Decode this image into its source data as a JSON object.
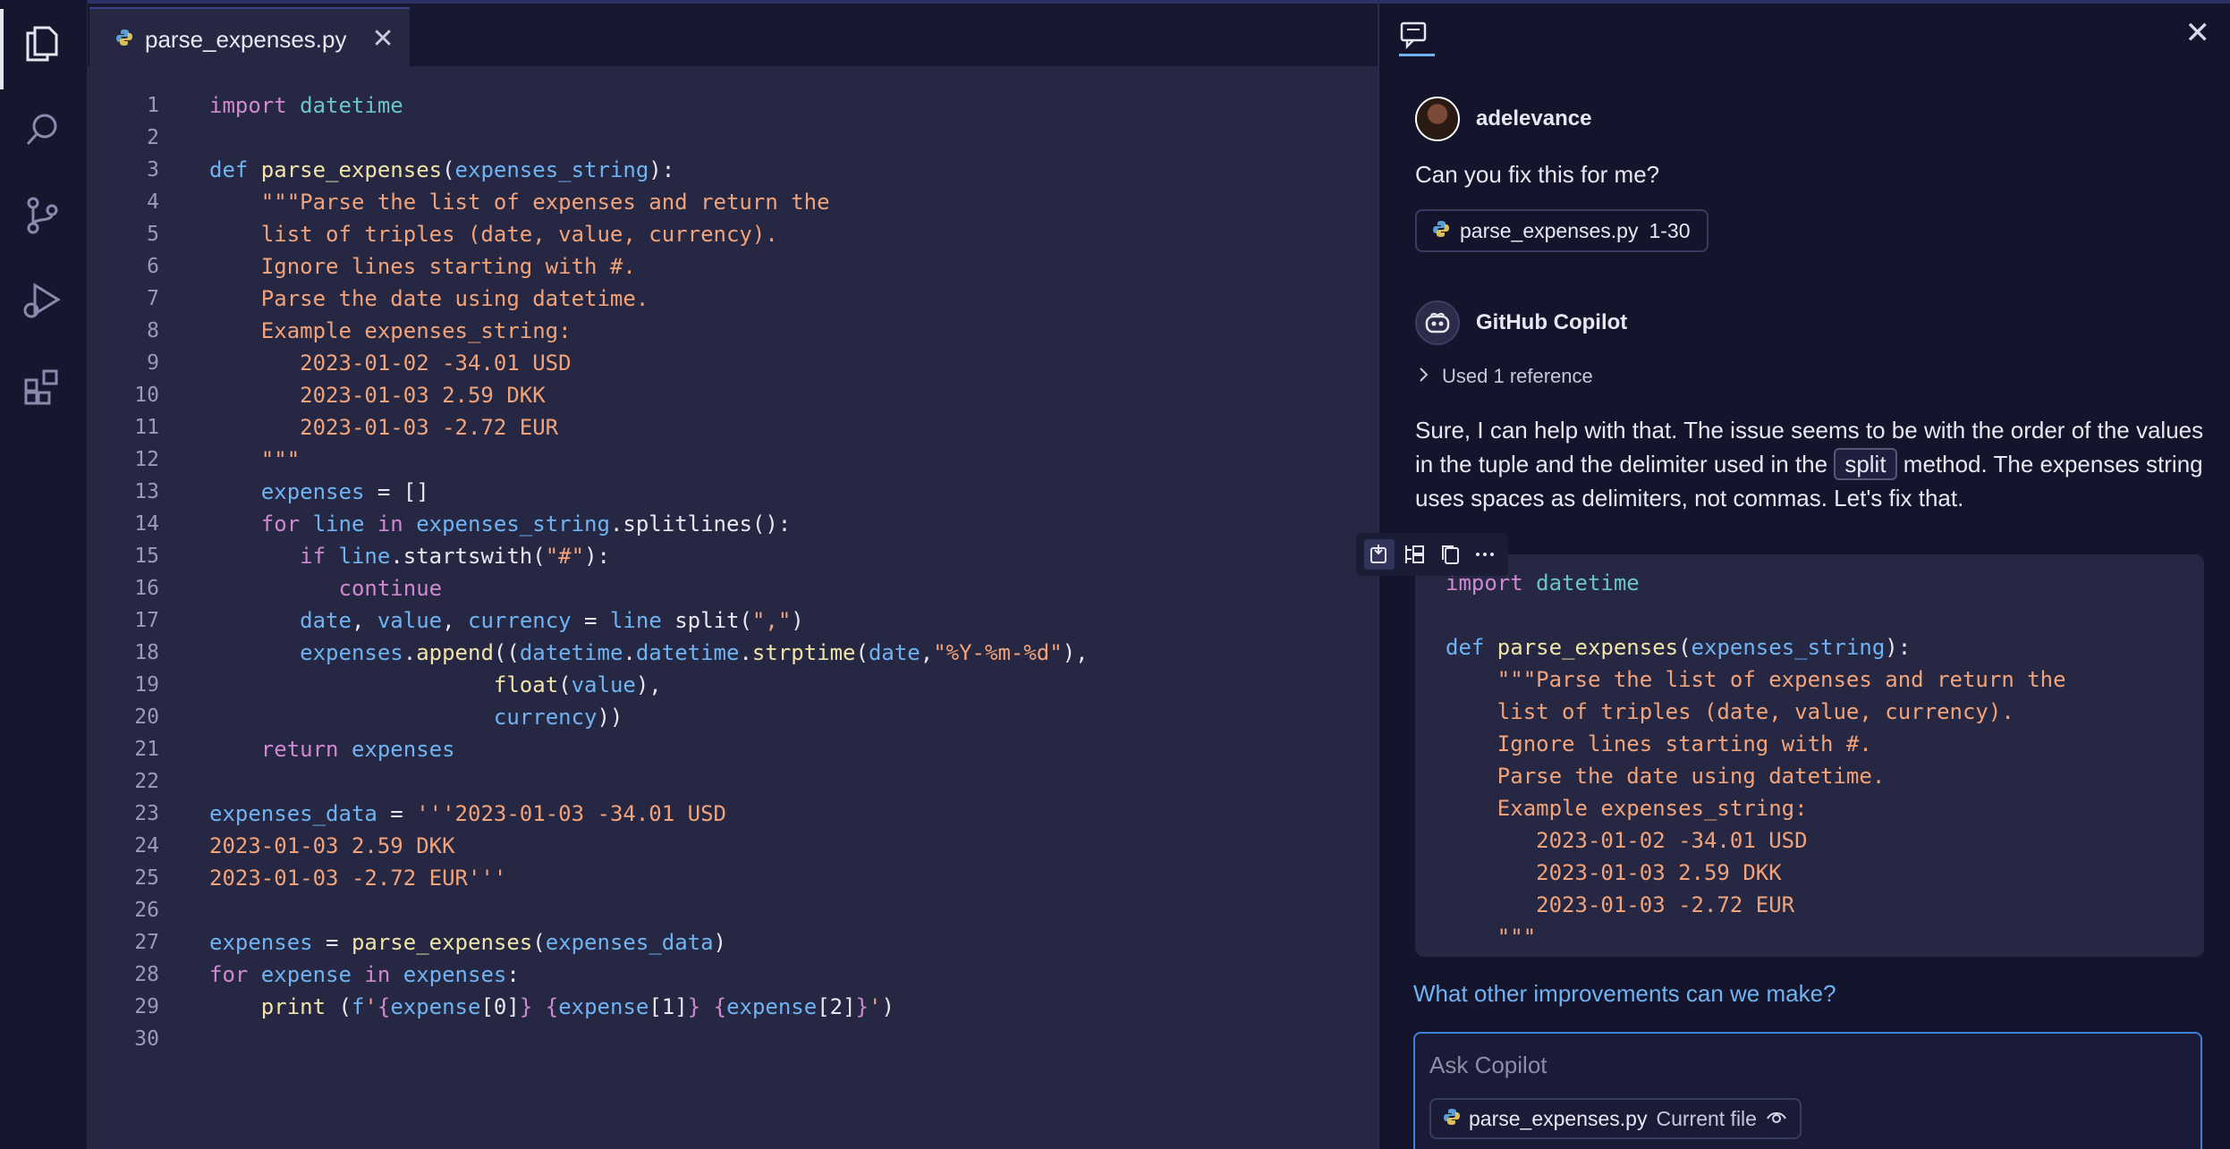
{
  "activity_bar": {
    "icons": [
      "files-icon",
      "search-icon",
      "source-control-icon",
      "run-debug-icon",
      "extensions-icon"
    ]
  },
  "editor": {
    "tab": {
      "title": "parse_expenses.py",
      "close": "✕"
    },
    "lines": [
      {
        "n": "1",
        "tokens": [
          [
            "k",
            "import "
          ],
          [
            "t",
            "datetime"
          ]
        ]
      },
      {
        "n": "2",
        "tokens": []
      },
      {
        "n": "3",
        "tokens": [
          [
            "b",
            "def "
          ],
          [
            "f",
            "parse_expenses"
          ],
          [
            "p",
            "("
          ],
          [
            "b",
            "expenses_string"
          ],
          [
            "p",
            "):"
          ]
        ]
      },
      {
        "n": "4",
        "tokens": [
          [
            "s",
            "    \"\"\"Parse the list of expenses and return the"
          ]
        ]
      },
      {
        "n": "5",
        "tokens": [
          [
            "s",
            "    list of triples (date, value, currency)."
          ]
        ]
      },
      {
        "n": "6",
        "tokens": [
          [
            "s",
            "    Ignore lines starting with #."
          ]
        ]
      },
      {
        "n": "7",
        "tokens": [
          [
            "s",
            "    Parse the date using datetime."
          ]
        ]
      },
      {
        "n": "8",
        "tokens": [
          [
            "s",
            "    Example expenses_string:"
          ]
        ]
      },
      {
        "n": "9",
        "tokens": [
          [
            "s",
            "       2023-01-02 -34.01 USD"
          ]
        ]
      },
      {
        "n": "10",
        "tokens": [
          [
            "s",
            "       2023-01-03 2.59 DKK"
          ]
        ]
      },
      {
        "n": "11",
        "tokens": [
          [
            "s",
            "       2023-01-03 -2.72 EUR"
          ]
        ]
      },
      {
        "n": "12",
        "tokens": [
          [
            "s",
            "    \"\"\""
          ]
        ]
      },
      {
        "n": "13",
        "tokens": [
          [
            "w",
            "    "
          ],
          [
            "b",
            "expenses"
          ],
          [
            "p",
            " = []"
          ]
        ]
      },
      {
        "n": "14",
        "tokens": [
          [
            "w",
            "    "
          ],
          [
            "k",
            "for "
          ],
          [
            "b",
            "line "
          ],
          [
            "k",
            "in "
          ],
          [
            "b",
            "expenses_string"
          ],
          [
            "p",
            ".splitlines():"
          ]
        ]
      },
      {
        "n": "15",
        "tokens": [
          [
            "w",
            "       "
          ],
          [
            "k",
            "if "
          ],
          [
            "b",
            "line"
          ],
          [
            "p",
            ".startswith("
          ],
          [
            "s",
            "\"#\""
          ],
          [
            "p",
            "):"
          ]
        ]
      },
      {
        "n": "16",
        "tokens": [
          [
            "w",
            "          "
          ],
          [
            "k",
            "continue"
          ]
        ]
      },
      {
        "n": "17",
        "tokens": [
          [
            "w",
            "       "
          ],
          [
            "b",
            "date"
          ],
          [
            "p",
            ", "
          ],
          [
            "b",
            "value"
          ],
          [
            "p",
            ", "
          ],
          [
            "b",
            "currency"
          ],
          [
            "p",
            " = "
          ],
          [
            "b",
            "line "
          ],
          [
            "p",
            "split("
          ],
          [
            "s",
            "\",\""
          ],
          [
            "p",
            ")"
          ]
        ]
      },
      {
        "n": "18",
        "tokens": [
          [
            "w",
            "       "
          ],
          [
            "b",
            "expenses"
          ],
          [
            "p",
            "."
          ],
          [
            "f",
            "append"
          ],
          [
            "p",
            "(("
          ],
          [
            "b",
            "datetime"
          ],
          [
            "p",
            "."
          ],
          [
            "b",
            "datetime"
          ],
          [
            "p",
            "."
          ],
          [
            "f",
            "strptime"
          ],
          [
            "p",
            "("
          ],
          [
            "b",
            "date"
          ],
          [
            "p",
            ","
          ],
          [
            "s",
            "\"%Y-%m-%d\""
          ],
          [
            "p",
            "),"
          ]
        ]
      },
      {
        "n": "19",
        "tokens": [
          [
            "w",
            "                      "
          ],
          [
            "f",
            "float"
          ],
          [
            "p",
            "("
          ],
          [
            "b",
            "value"
          ],
          [
            "p",
            "),"
          ]
        ]
      },
      {
        "n": "20",
        "tokens": [
          [
            "w",
            "                      "
          ],
          [
            "b",
            "currency"
          ],
          [
            "p",
            "))"
          ]
        ]
      },
      {
        "n": "21",
        "tokens": [
          [
            "w",
            "    "
          ],
          [
            "k",
            "return "
          ],
          [
            "b",
            "expenses"
          ]
        ]
      },
      {
        "n": "22",
        "tokens": []
      },
      {
        "n": "23",
        "tokens": [
          [
            "b",
            "expenses_data"
          ],
          [
            "p",
            " = "
          ],
          [
            "s",
            "'''2023-01-03 -34.01 USD"
          ]
        ]
      },
      {
        "n": "24",
        "tokens": [
          [
            "s",
            "2023-01-03 2.59 DKK"
          ]
        ]
      },
      {
        "n": "25",
        "tokens": [
          [
            "s",
            "2023-01-03 -2.72 EUR'''"
          ]
        ]
      },
      {
        "n": "26",
        "tokens": []
      },
      {
        "n": "27",
        "tokens": [
          [
            "b",
            "expenses"
          ],
          [
            "p",
            " = "
          ],
          [
            "f",
            "parse_expenses"
          ],
          [
            "p",
            "("
          ],
          [
            "b",
            "expenses_data"
          ],
          [
            "p",
            ")"
          ]
        ]
      },
      {
        "n": "28",
        "tokens": [
          [
            "k",
            "for "
          ],
          [
            "b",
            "expense "
          ],
          [
            "k",
            "in "
          ],
          [
            "b",
            "expenses"
          ],
          [
            "p",
            ":"
          ]
        ]
      },
      {
        "n": "29",
        "tokens": [
          [
            "w",
            "    "
          ],
          [
            "f",
            "print "
          ],
          [
            "p",
            "("
          ],
          [
            "b",
            "f"
          ],
          [
            "s",
            "'"
          ],
          [
            "k",
            "{"
          ],
          [
            "b",
            "expense"
          ],
          [
            "p",
            "[0]"
          ],
          [
            "k",
            "}"
          ],
          [
            "s",
            " "
          ],
          [
            "k",
            "{"
          ],
          [
            "b",
            "expense"
          ],
          [
            "p",
            "[1]"
          ],
          [
            "k",
            "}"
          ],
          [
            "s",
            " "
          ],
          [
            "k",
            "{"
          ],
          [
            "b",
            "expense"
          ],
          [
            "p",
            "[2]"
          ],
          [
            "k",
            "}"
          ],
          [
            "s",
            "'"
          ],
          [
            "p",
            ")"
          ]
        ]
      },
      {
        "n": "30",
        "tokens": []
      }
    ]
  },
  "chat": {
    "close": "✕",
    "user": {
      "name": "adelevance",
      "message": "Can you fix this for me?"
    },
    "reference_chip": {
      "file": "parse_expenses.py",
      "range": "1-30"
    },
    "assistant": {
      "name": "GitHub Copilot",
      "used_reference": "Used 1 reference"
    },
    "reply": {
      "before": "Sure, I can help with that. The issue seems to be with the order of the values in the tuple and the delimiter used in the ",
      "code": "split",
      "after": " method. The expenses string uses spaces as delimiters, not commas. Let's fix that."
    },
    "codeblock": [
      {
        "tokens": [
          [
            "k",
            "import "
          ],
          [
            "t",
            "datetime"
          ]
        ]
      },
      {
        "tokens": []
      },
      {
        "tokens": [
          [
            "b",
            "def "
          ],
          [
            "f",
            "parse_expenses"
          ],
          [
            "p",
            "("
          ],
          [
            "b",
            "expenses_string"
          ],
          [
            "p",
            "):"
          ]
        ]
      },
      {
        "tokens": [
          [
            "s",
            "    \"\"\"Parse the list of expenses and return the"
          ]
        ]
      },
      {
        "tokens": [
          [
            "s",
            "    list of triples (date, value, currency)."
          ]
        ]
      },
      {
        "tokens": [
          [
            "s",
            "    Ignore lines starting with #."
          ]
        ]
      },
      {
        "tokens": [
          [
            "s",
            "    Parse the date using datetime."
          ]
        ]
      },
      {
        "tokens": [
          [
            "s",
            "    Example expenses_string:"
          ]
        ]
      },
      {
        "tokens": [
          [
            "s",
            "       2023-01-02 -34.01 USD"
          ]
        ]
      },
      {
        "tokens": [
          [
            "s",
            "       2023-01-03 2.59 DKK"
          ]
        ]
      },
      {
        "tokens": [
          [
            "s",
            "       2023-01-03 -2.72 EUR"
          ]
        ]
      },
      {
        "tokens": [
          [
            "s",
            "    \"\"\""
          ]
        ]
      }
    ],
    "suggestion": "What other improvements can we make?",
    "input": {
      "placeholder": "Ask Copilot",
      "context_file": "parse_expenses.py",
      "context_label": "Current file"
    }
  }
}
